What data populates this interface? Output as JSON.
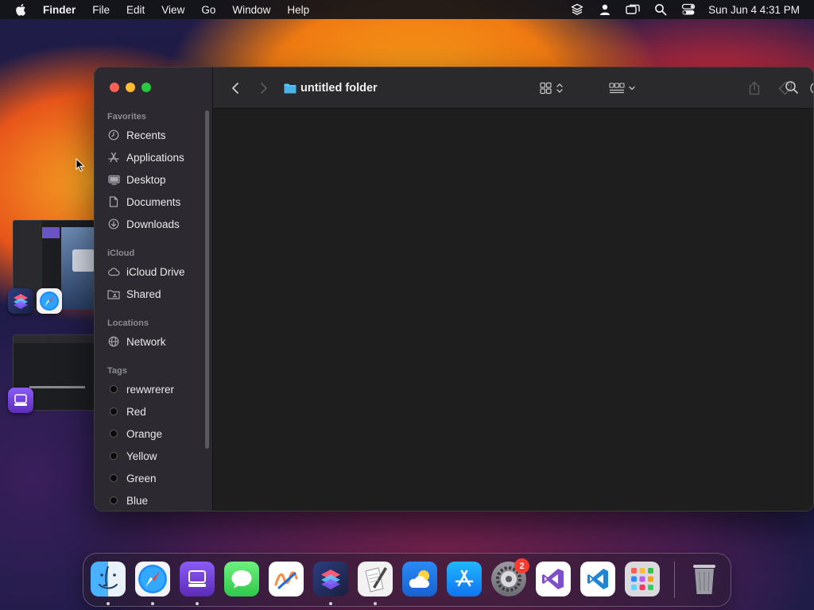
{
  "menubar": {
    "app_name": "Finder",
    "menus": [
      "File",
      "Edit",
      "View",
      "Go",
      "Window",
      "Help"
    ],
    "status_icons": [
      "layers-icon",
      "user-icon",
      "screen-mirroring-icon",
      "spotlight-search-icon",
      "control-center-icon"
    ],
    "clock": "Sun Jun 4  4:31 PM"
  },
  "finder": {
    "folder_title": "untitled folder",
    "toolbar_icons": [
      "back-icon",
      "forward-icon",
      "icon-view-icon",
      "group-icon",
      "share-icon",
      "tag-icon",
      "more-actions-icon",
      "search-icon"
    ],
    "sidebar": {
      "favorites_title": "Favorites",
      "favorites": [
        {
          "label": "Recents",
          "icon": "clock-icon"
        },
        {
          "label": "Applications",
          "icon": "applications-icon"
        },
        {
          "label": "Desktop",
          "icon": "desktop-icon"
        },
        {
          "label": "Documents",
          "icon": "document-icon"
        },
        {
          "label": "Downloads",
          "icon": "download-icon"
        }
      ],
      "icloud_title": "iCloud",
      "icloud": [
        {
          "label": "iCloud Drive",
          "icon": "cloud-icon"
        },
        {
          "label": "Shared",
          "icon": "shared-folder-icon"
        }
      ],
      "locations_title": "Locations",
      "locations": [
        {
          "label": "Network",
          "icon": "globe-icon"
        }
      ],
      "tags_title": "Tags",
      "tags": [
        "rewwrerer",
        "Red",
        "Orange",
        "Yellow",
        "Green",
        "Blue"
      ]
    }
  },
  "dock": {
    "apps": [
      "Finder",
      "Safari",
      "Apple Configurator",
      "Messages",
      "Freeform",
      "Shortcuts",
      "Script Editor",
      "Weather",
      "App Store",
      "System Settings",
      "Visual Studio",
      "Visual Studio Code",
      "Launchpad",
      "Trash"
    ],
    "settings_badge": "2"
  },
  "colors": {
    "window_bg": "#1e1e1e",
    "sidebar_bg": "#2c2a30",
    "close": "#ff5f57",
    "minimize": "#febc2e",
    "zoom": "#28c840",
    "folder_blue": "#5ac8fa"
  }
}
